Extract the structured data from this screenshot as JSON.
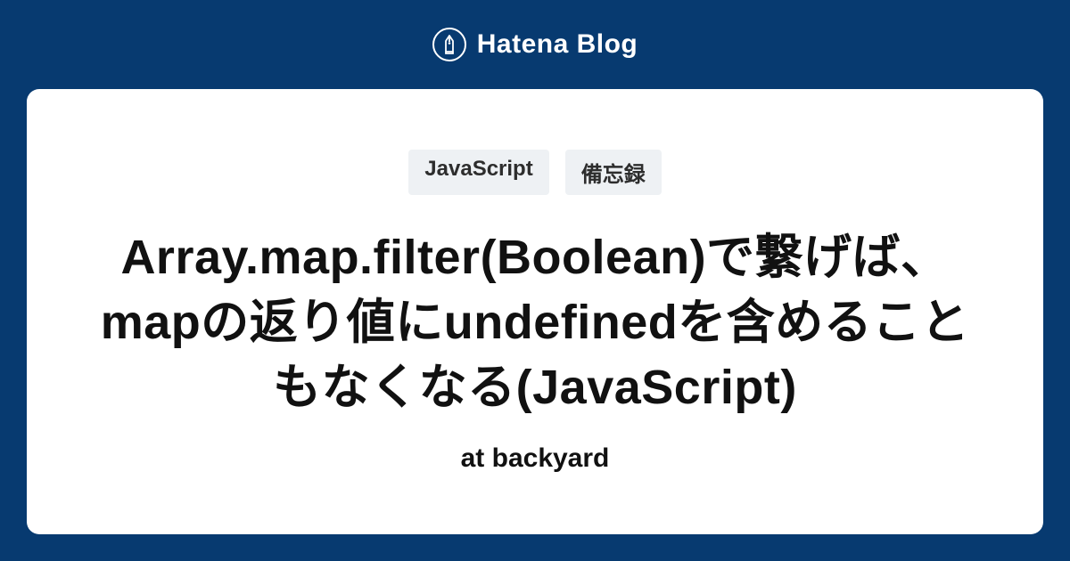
{
  "header": {
    "brand": "Hatena Blog"
  },
  "card": {
    "tags": [
      "JavaScript",
      "備忘録"
    ],
    "title": "Array.map.filter(Boolean)で繋げば、mapの返り値にundefinedを含めることもなくなる(JavaScript)",
    "subtitle": "at backyard"
  },
  "colors": {
    "background": "#073a70",
    "card_bg": "#ffffff",
    "tag_bg": "#eef1f4"
  }
}
